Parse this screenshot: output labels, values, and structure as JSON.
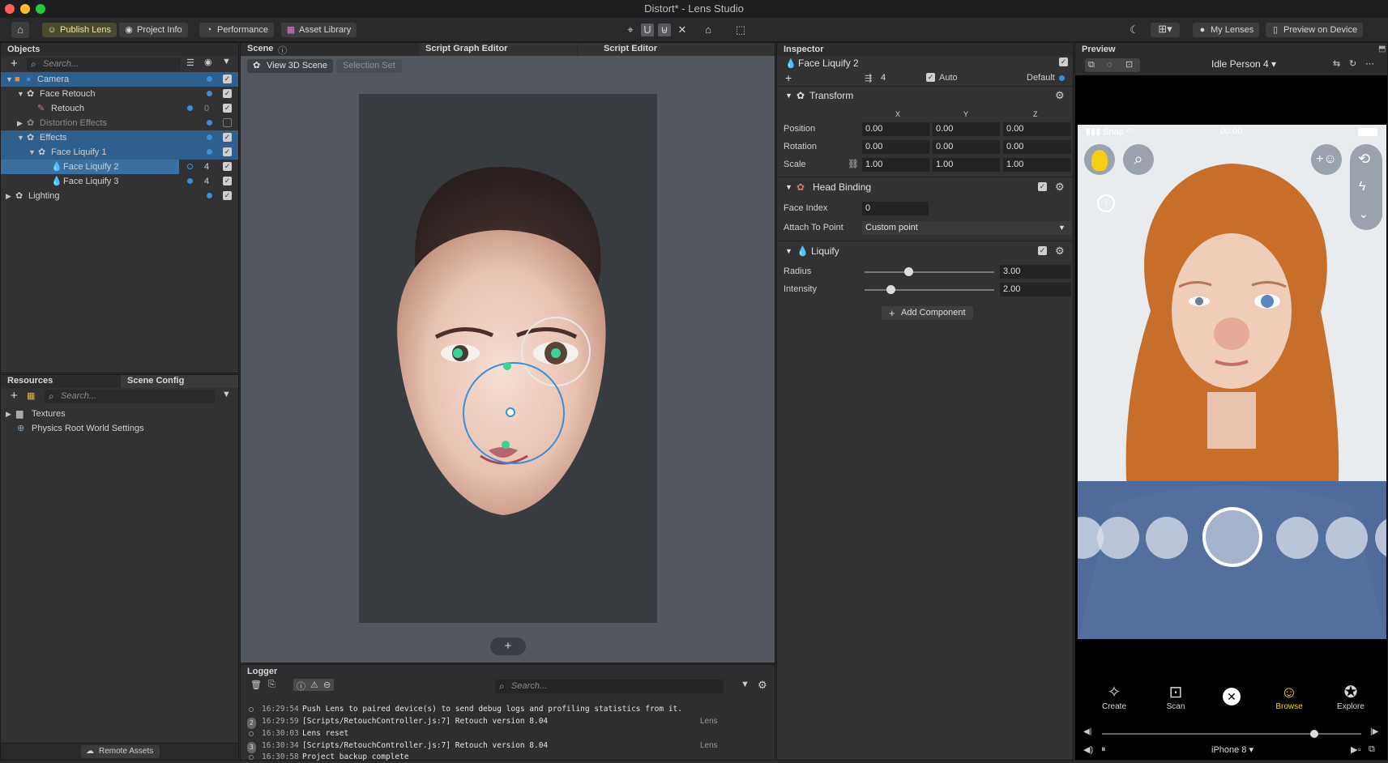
{
  "window": {
    "title": "Distort* - Lens Studio"
  },
  "toolbar": {
    "publish": "Publish Lens",
    "project_info": "Project Info",
    "performance": "Performance",
    "asset_library": "Asset Library",
    "my_lenses": "My Lenses",
    "preview_on_device": "Preview on Device"
  },
  "objects": {
    "title": "Objects",
    "search_placeholder": "Search...",
    "items": [
      {
        "label": "Camera",
        "num": ""
      },
      {
        "label": "Face Retouch",
        "num": ""
      },
      {
        "label": "Retouch",
        "num": "0"
      },
      {
        "label": "Distortion Effects",
        "num": ""
      },
      {
        "label": "Effects",
        "num": ""
      },
      {
        "label": "Face Liquify 1",
        "num": ""
      },
      {
        "label": "Face Liquify 2",
        "num": "4"
      },
      {
        "label": "Face Liquify 3",
        "num": "4"
      },
      {
        "label": "Lighting",
        "num": ""
      }
    ]
  },
  "resources": {
    "tab1": "Resources",
    "tab2": "Scene Config",
    "search_placeholder": "Search...",
    "items": [
      {
        "label": "Textures"
      },
      {
        "label": "Physics Root World Settings"
      }
    ],
    "remote_assets": "Remote Assets"
  },
  "scene": {
    "tab1": "Scene",
    "tab2": "Script Graph Editor",
    "tab3": "Script Editor",
    "view_3d": "View 3D Scene",
    "selection_set": "Selection Set",
    "add": "+"
  },
  "logger": {
    "title": "Logger",
    "search_placeholder": "Search...",
    "entries": [
      {
        "time": "16:29:54",
        "msg": "Push Lens to paired device(s) to send debug logs and profiling statistics from it.",
        "src": "",
        "count": ""
      },
      {
        "time": "16:29:59",
        "msg": "[Scripts/RetouchController.js:7] Retouch version 8.04",
        "src": "Lens",
        "count": "2"
      },
      {
        "time": "16:30:03",
        "msg": "Lens reset",
        "src": "",
        "count": ""
      },
      {
        "time": "16:30:34",
        "msg": "[Scripts/RetouchController.js:7] Retouch version 8.04",
        "src": "Lens",
        "count": "3"
      },
      {
        "time": "16:30:58",
        "msg": "Project backup complete",
        "src": "",
        "count": ""
      }
    ]
  },
  "inspector": {
    "title": "Inspector",
    "object_name": "Face Liquify 2",
    "layer": "4",
    "auto": "Auto",
    "default": "Default",
    "transform": {
      "title": "Transform",
      "x": "X",
      "y": "Y",
      "z": "Z",
      "position_label": "Position",
      "position": [
        "0.00",
        "0.00",
        "0.00"
      ],
      "rotation_label": "Rotation",
      "rotation": [
        "0.00",
        "0.00",
        "0.00"
      ],
      "scale_label": "Scale",
      "scale": [
        "1.00",
        "1.00",
        "1.00"
      ]
    },
    "head_binding": {
      "title": "Head Binding",
      "face_index_label": "Face Index",
      "face_index": "0",
      "attach_label": "Attach To Point",
      "attach": "Custom point"
    },
    "liquify": {
      "title": "Liquify",
      "radius_label": "Radius",
      "radius": "3.00",
      "radius_fraction": 0.34,
      "intensity_label": "Intensity",
      "intensity": "2.00",
      "intensity_fraction": 0.2
    },
    "add_component": "Add Component"
  },
  "preview": {
    "title": "Preview",
    "person": "Idle Person 4",
    "carrier": "Snap",
    "time": "00:00",
    "nav": {
      "create": "Create",
      "scan": "Scan",
      "browse": "Browse",
      "explore": "Explore"
    },
    "device": "iPhone 8",
    "timeline_fraction": 0.82
  },
  "colors": {
    "accent": "#3b8fd9",
    "selection": "#2f5f8c",
    "browse": "#f5d60f",
    "handle": "#3ad39a"
  }
}
